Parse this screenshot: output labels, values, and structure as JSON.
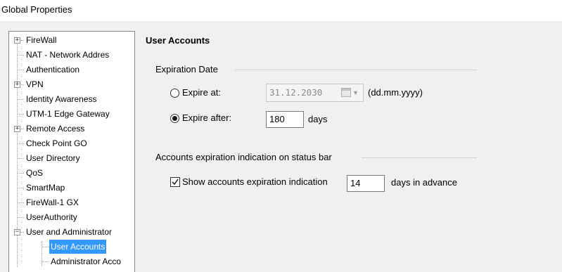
{
  "window": {
    "title": "Global Properties"
  },
  "tree": {
    "items": [
      {
        "label": "FireWall",
        "expander": "+"
      },
      {
        "label": "NAT - Network Addres"
      },
      {
        "label": "Authentication"
      },
      {
        "label": "VPN",
        "expander": "+"
      },
      {
        "label": "Identity Awareness"
      },
      {
        "label": "UTM-1 Edge Gateway"
      },
      {
        "label": "Remote Access",
        "expander": "+"
      },
      {
        "label": "Check Point GO"
      },
      {
        "label": "User Directory"
      },
      {
        "label": "QoS"
      },
      {
        "label": "SmartMap"
      },
      {
        "label": "FireWall-1 GX"
      },
      {
        "label": "UserAuthority"
      },
      {
        "label": "User and Administrator",
        "expander": "-"
      },
      {
        "label": "User Accounts",
        "selected": true
      },
      {
        "label": "Administrator Acco"
      }
    ]
  },
  "pane": {
    "title": "User Accounts",
    "expiration_group": "Expiration Date",
    "expire_at_label": "Expire at:",
    "expire_at_selected": false,
    "expire_at_date": "31.12.2030",
    "date_format": "(dd.mm.yyyy)",
    "expire_after_label": "Expire after:",
    "expire_after_selected": true,
    "expire_after_value": "180",
    "days_label": "days",
    "indication_group": "Accounts expiration indication on status bar",
    "show_indication_label": "Show accounts expiration indication",
    "show_indication_checked": true,
    "advance_days_value": "14",
    "advance_days_label": "days in advance"
  },
  "colors": {
    "selection": "#3399ff",
    "tree_border": "#828790"
  },
  "icons": {
    "expand": "plus-box-icon",
    "collapse": "minus-box-icon",
    "calendar": "calendar-icon",
    "checkmark": "checkmark-icon"
  }
}
